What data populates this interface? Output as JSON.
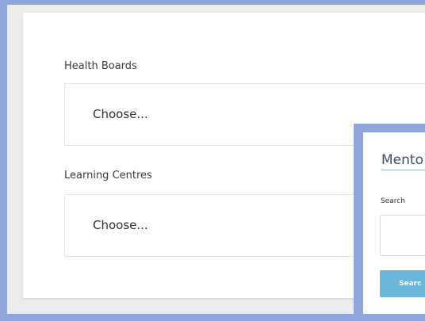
{
  "form": {
    "health_boards": {
      "label": "Health Boards",
      "selected": "Choose..."
    },
    "learning_centres": {
      "label": "Learning Centres",
      "selected": "Choose..."
    }
  },
  "mentor_panel": {
    "title": "Mento",
    "search_label": "Search",
    "search_value": "",
    "search_button_label": "Searc"
  },
  "colors": {
    "frame_border": "#8ea6dc",
    "page_background": "#ececec",
    "card_background": "#ffffff",
    "button_background": "#6ab7da",
    "title_text": "#3d4f6f"
  }
}
